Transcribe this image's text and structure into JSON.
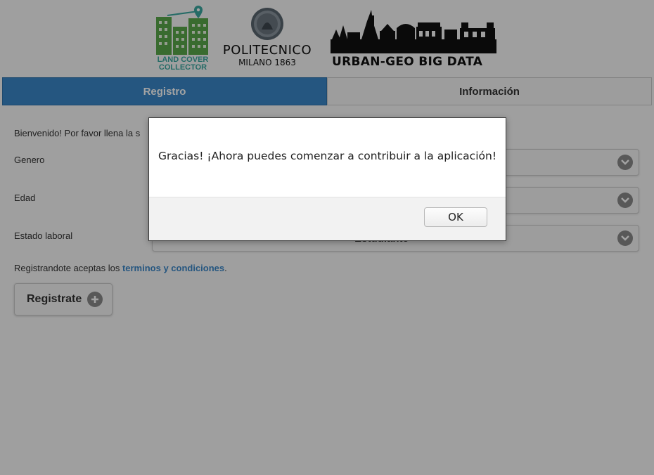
{
  "header": {
    "logo_lcc_line1": "LAND COVER",
    "logo_lcc_line2": "COLLECTOR",
    "logo_polimi_name": "POLITECNICO",
    "logo_polimi_sub": "MILANO 1863",
    "logo_urban_text": "URBAN-GEO BIG DATA"
  },
  "tabs": [
    {
      "label": "Registro",
      "active": true
    },
    {
      "label": "Información",
      "active": false
    }
  ],
  "form": {
    "intro_text": "Bienvenido! Por favor llena la s",
    "fields": [
      {
        "label": "Genero",
        "value": ""
      },
      {
        "label": "Edad",
        "value": ""
      },
      {
        "label": "Estado laboral",
        "value": "Estudiante"
      }
    ],
    "terms_prefix": "Registrandote aceptas los ",
    "terms_link": "terminos y condiciones",
    "terms_suffix": ".",
    "register_label": "Registrate"
  },
  "dialog": {
    "message": "Gracias! ¡Ahora puedes comenzar a contribuir a la aplicación!",
    "ok_label": "OK"
  },
  "colors": {
    "accent": "#3a87c8",
    "lcc_green": "#5aa84a",
    "lcc_teal": "#3aa8a0"
  }
}
